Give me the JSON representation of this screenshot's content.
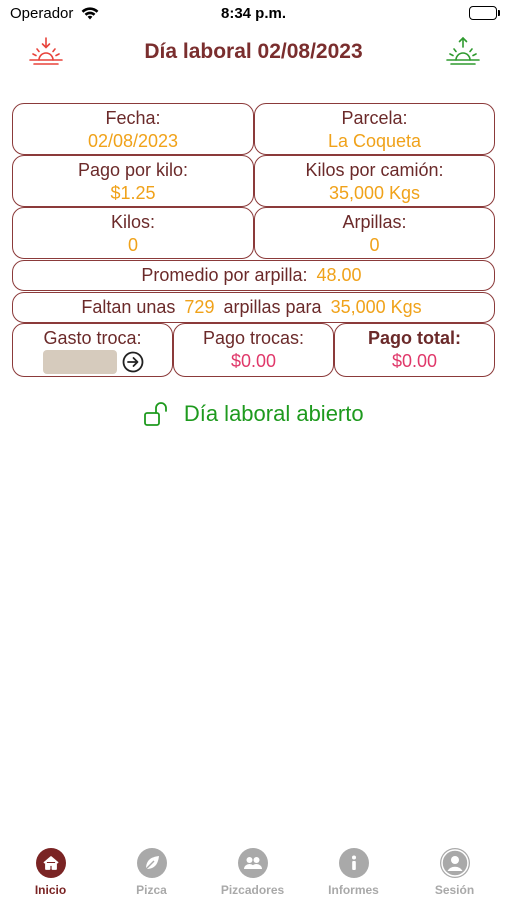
{
  "status_bar": {
    "carrier": "Operador",
    "time": "8:34 p.m.",
    "icons": [
      "wifi-icon",
      "battery-icon"
    ]
  },
  "header": {
    "title": "Día laboral 02/08/2023",
    "left_icon": "sunset-icon",
    "right_icon": "sunrise-icon",
    "colors": {
      "left_icon": "#e8423a",
      "right_icon": "#2e9a2e",
      "title": "#7a2e2e"
    }
  },
  "fields": {
    "fecha": {
      "label": "Fecha:",
      "value": "02/08/2023"
    },
    "parcela": {
      "label": "Parcela:",
      "value": "La Coqueta"
    },
    "pago_por_kilo": {
      "label": "Pago por kilo:",
      "value": "$1.25"
    },
    "kilos_por_camion": {
      "label": "Kilos por camión:",
      "value": "35,000 Kgs"
    },
    "kilos": {
      "label": "Kilos:",
      "value": "0"
    },
    "arpillas": {
      "label": "Arpillas:",
      "value": "0"
    }
  },
  "promedio": {
    "label": "Promedio por arpilla:",
    "value": "48.00"
  },
  "faltan": {
    "prefix": "Faltan unas",
    "count": "729",
    "middle": "arpillas para",
    "target": "35,000 Kgs"
  },
  "gasto_troca": {
    "label": "Gasto troca:",
    "input_value": "",
    "submit_icon": "arrow-right-circle-icon"
  },
  "pago_trocas": {
    "label": "Pago trocas:",
    "value": "$0.00"
  },
  "pago_total": {
    "label": "Pago total:",
    "value": "$0.00"
  },
  "day_status": {
    "icon": "unlock-icon",
    "text": "Día laboral abierto",
    "color": "#1e9a1e"
  },
  "tab_bar": {
    "active": "Inicio",
    "tabs": [
      {
        "label": "Inicio",
        "icon": "home-icon"
      },
      {
        "label": "Pizca",
        "icon": "leaf-icon"
      },
      {
        "label": "Pizcadores",
        "icon": "people-icon"
      },
      {
        "label": "Informes",
        "icon": "info-icon"
      },
      {
        "label": "Sesión",
        "icon": "user-icon"
      }
    ]
  },
  "colors": {
    "accent": "#7a2424",
    "value_orange": "#f0a21a",
    "value_pink": "#e0386a",
    "border": "#8b3a3a",
    "inactive": "#a9a9a9"
  }
}
